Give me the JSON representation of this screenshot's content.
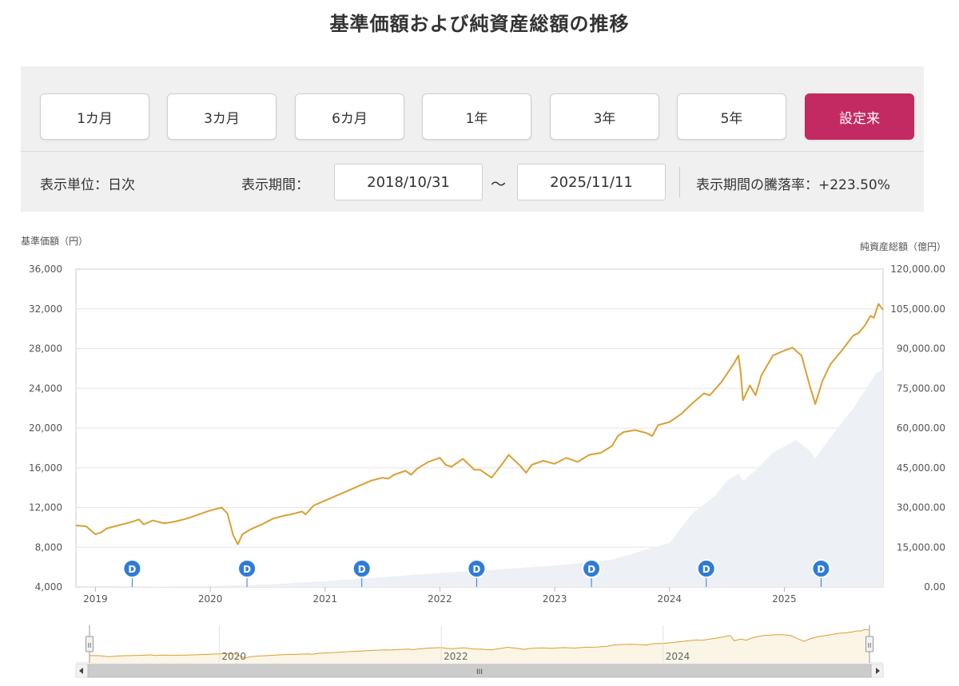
{
  "page": {
    "title": "基準価額および純資産総額の推移"
  },
  "periods": [
    "1カ月",
    "3カ月",
    "6カ月",
    "1年",
    "3年",
    "5年",
    "設定来"
  ],
  "active_period": "設定来",
  "info": {
    "unit": "表示単位：日次",
    "period_label": "表示期間：",
    "start_date": "2018/10/31",
    "tilde": "〜",
    "end_date": "2025/11/11",
    "change": "表示期間の騰落率：+223.50%"
  },
  "colors": {
    "accent": "#c32a62",
    "price_line": "#d9a032",
    "assets_area": "#edf0f5",
    "dividend_marker": "#2f7bd8"
  },
  "chart_data": {
    "type": "line",
    "y_left_label": "基準価額（円）",
    "y_right_label": "純資産総額（億円）",
    "y_left_range": [
      4000,
      36000
    ],
    "y_left_ticks": [
      "4,000",
      "8,000",
      "12,000",
      "16,000",
      "20,000",
      "24,000",
      "28,000",
      "32,000",
      "36,000"
    ],
    "y_right_range": [
      0,
      120000
    ],
    "y_right_ticks": [
      "0.00",
      "15,000.00",
      "30,000.00",
      "45,000.00",
      "60,000.00",
      "75,000.00",
      "90,000.00",
      "105,000.00",
      "120,000.00"
    ],
    "x_range": [
      2018.83,
      2025.86
    ],
    "x_ticks": [
      "2019",
      "2020",
      "2021",
      "2022",
      "2023",
      "2024",
      "2025"
    ],
    "legend": "none",
    "grid": true,
    "series": [
      {
        "name": "基準価額",
        "points": [
          [
            2018.83,
            10200
          ],
          [
            2018.92,
            10100
          ],
          [
            2019.0,
            9300
          ],
          [
            2019.05,
            9500
          ],
          [
            2019.1,
            9900
          ],
          [
            2019.2,
            10200
          ],
          [
            2019.3,
            10500
          ],
          [
            2019.38,
            10800
          ],
          [
            2019.42,
            10300
          ],
          [
            2019.5,
            10700
          ],
          [
            2019.6,
            10400
          ],
          [
            2019.7,
            10600
          ],
          [
            2019.8,
            10900
          ],
          [
            2019.9,
            11300
          ],
          [
            2020.0,
            11700
          ],
          [
            2020.1,
            12000
          ],
          [
            2020.15,
            11400
          ],
          [
            2020.2,
            9200
          ],
          [
            2020.24,
            8300
          ],
          [
            2020.28,
            9300
          ],
          [
            2020.35,
            9800
          ],
          [
            2020.45,
            10300
          ],
          [
            2020.55,
            10900
          ],
          [
            2020.65,
            11200
          ],
          [
            2020.7,
            11300
          ],
          [
            2020.8,
            11600
          ],
          [
            2020.83,
            11300
          ],
          [
            2020.9,
            12200
          ],
          [
            2021.0,
            12700
          ],
          [
            2021.1,
            13200
          ],
          [
            2021.2,
            13700
          ],
          [
            2021.3,
            14200
          ],
          [
            2021.4,
            14700
          ],
          [
            2021.5,
            15000
          ],
          [
            2021.55,
            14900
          ],
          [
            2021.6,
            15300
          ],
          [
            2021.7,
            15700
          ],
          [
            2021.75,
            15300
          ],
          [
            2021.8,
            15900
          ],
          [
            2021.9,
            16600
          ],
          [
            2022.0,
            17000
          ],
          [
            2022.05,
            16300
          ],
          [
            2022.1,
            16100
          ],
          [
            2022.2,
            16900
          ],
          [
            2022.3,
            15800
          ],
          [
            2022.35,
            15800
          ],
          [
            2022.45,
            15000
          ],
          [
            2022.55,
            16500
          ],
          [
            2022.6,
            17300
          ],
          [
            2022.7,
            16200
          ],
          [
            2022.75,
            15500
          ],
          [
            2022.8,
            16300
          ],
          [
            2022.9,
            16700
          ],
          [
            2023.0,
            16400
          ],
          [
            2023.1,
            17000
          ],
          [
            2023.2,
            16600
          ],
          [
            2023.3,
            17300
          ],
          [
            2023.4,
            17500
          ],
          [
            2023.5,
            18200
          ],
          [
            2023.55,
            19200
          ],
          [
            2023.6,
            19600
          ],
          [
            2023.7,
            19800
          ],
          [
            2023.8,
            19500
          ],
          [
            2023.85,
            19200
          ],
          [
            2023.9,
            20300
          ],
          [
            2024.0,
            20600
          ],
          [
            2024.1,
            21400
          ],
          [
            2024.2,
            22500
          ],
          [
            2024.3,
            23500
          ],
          [
            2024.35,
            23300
          ],
          [
            2024.45,
            24600
          ],
          [
            2024.55,
            26300
          ],
          [
            2024.6,
            27300
          ],
          [
            2024.62,
            25600
          ],
          [
            2024.64,
            22800
          ],
          [
            2024.7,
            24300
          ],
          [
            2024.75,
            23300
          ],
          [
            2024.8,
            25300
          ],
          [
            2024.9,
            27300
          ],
          [
            2025.0,
            27800
          ],
          [
            2025.07,
            28100
          ],
          [
            2025.15,
            27300
          ],
          [
            2025.22,
            24300
          ],
          [
            2025.27,
            22400
          ],
          [
            2025.33,
            24700
          ],
          [
            2025.4,
            26400
          ],
          [
            2025.5,
            27800
          ],
          [
            2025.6,
            29300
          ],
          [
            2025.65,
            29600
          ],
          [
            2025.7,
            30300
          ],
          [
            2025.75,
            31300
          ],
          [
            2025.78,
            31100
          ],
          [
            2025.82,
            32500
          ],
          [
            2025.86,
            31900
          ]
        ]
      },
      {
        "name": "純資産総額",
        "points": [
          [
            2018.83,
            0
          ],
          [
            2019.5,
            120
          ],
          [
            2020.0,
            400
          ],
          [
            2020.5,
            900
          ],
          [
            2021.0,
            2200
          ],
          [
            2021.5,
            3700
          ],
          [
            2022.0,
            5300
          ],
          [
            2022.5,
            6600
          ],
          [
            2023.0,
            8100
          ],
          [
            2023.5,
            10300
          ],
          [
            2024.0,
            16600
          ],
          [
            2024.2,
            27800
          ],
          [
            2024.4,
            34600
          ],
          [
            2024.5,
            40000
          ],
          [
            2024.6,
            42900
          ],
          [
            2024.64,
            40000
          ],
          [
            2024.75,
            44000
          ],
          [
            2024.9,
            50700
          ],
          [
            2025.0,
            53000
          ],
          [
            2025.1,
            55500
          ],
          [
            2025.22,
            51500
          ],
          [
            2025.27,
            48500
          ],
          [
            2025.4,
            56500
          ],
          [
            2025.5,
            62000
          ],
          [
            2025.6,
            67200
          ],
          [
            2025.7,
            74200
          ],
          [
            2025.8,
            80700
          ],
          [
            2025.86,
            82200
          ]
        ]
      }
    ],
    "dividend_marks": [
      {
        "label": "D",
        "x": 2019.32
      },
      {
        "label": "D",
        "x": 2020.32
      },
      {
        "label": "D",
        "x": 2021.32
      },
      {
        "label": "D",
        "x": 2022.32
      },
      {
        "label": "D",
        "x": 2023.32
      },
      {
        "label": "D",
        "x": 2024.32
      },
      {
        "label": "D",
        "x": 2025.32
      }
    ],
    "navigator": {
      "tick_labels": [
        "2020",
        "2022",
        "2024"
      ],
      "scroll_grip": "III",
      "handle_grip": "II"
    }
  }
}
